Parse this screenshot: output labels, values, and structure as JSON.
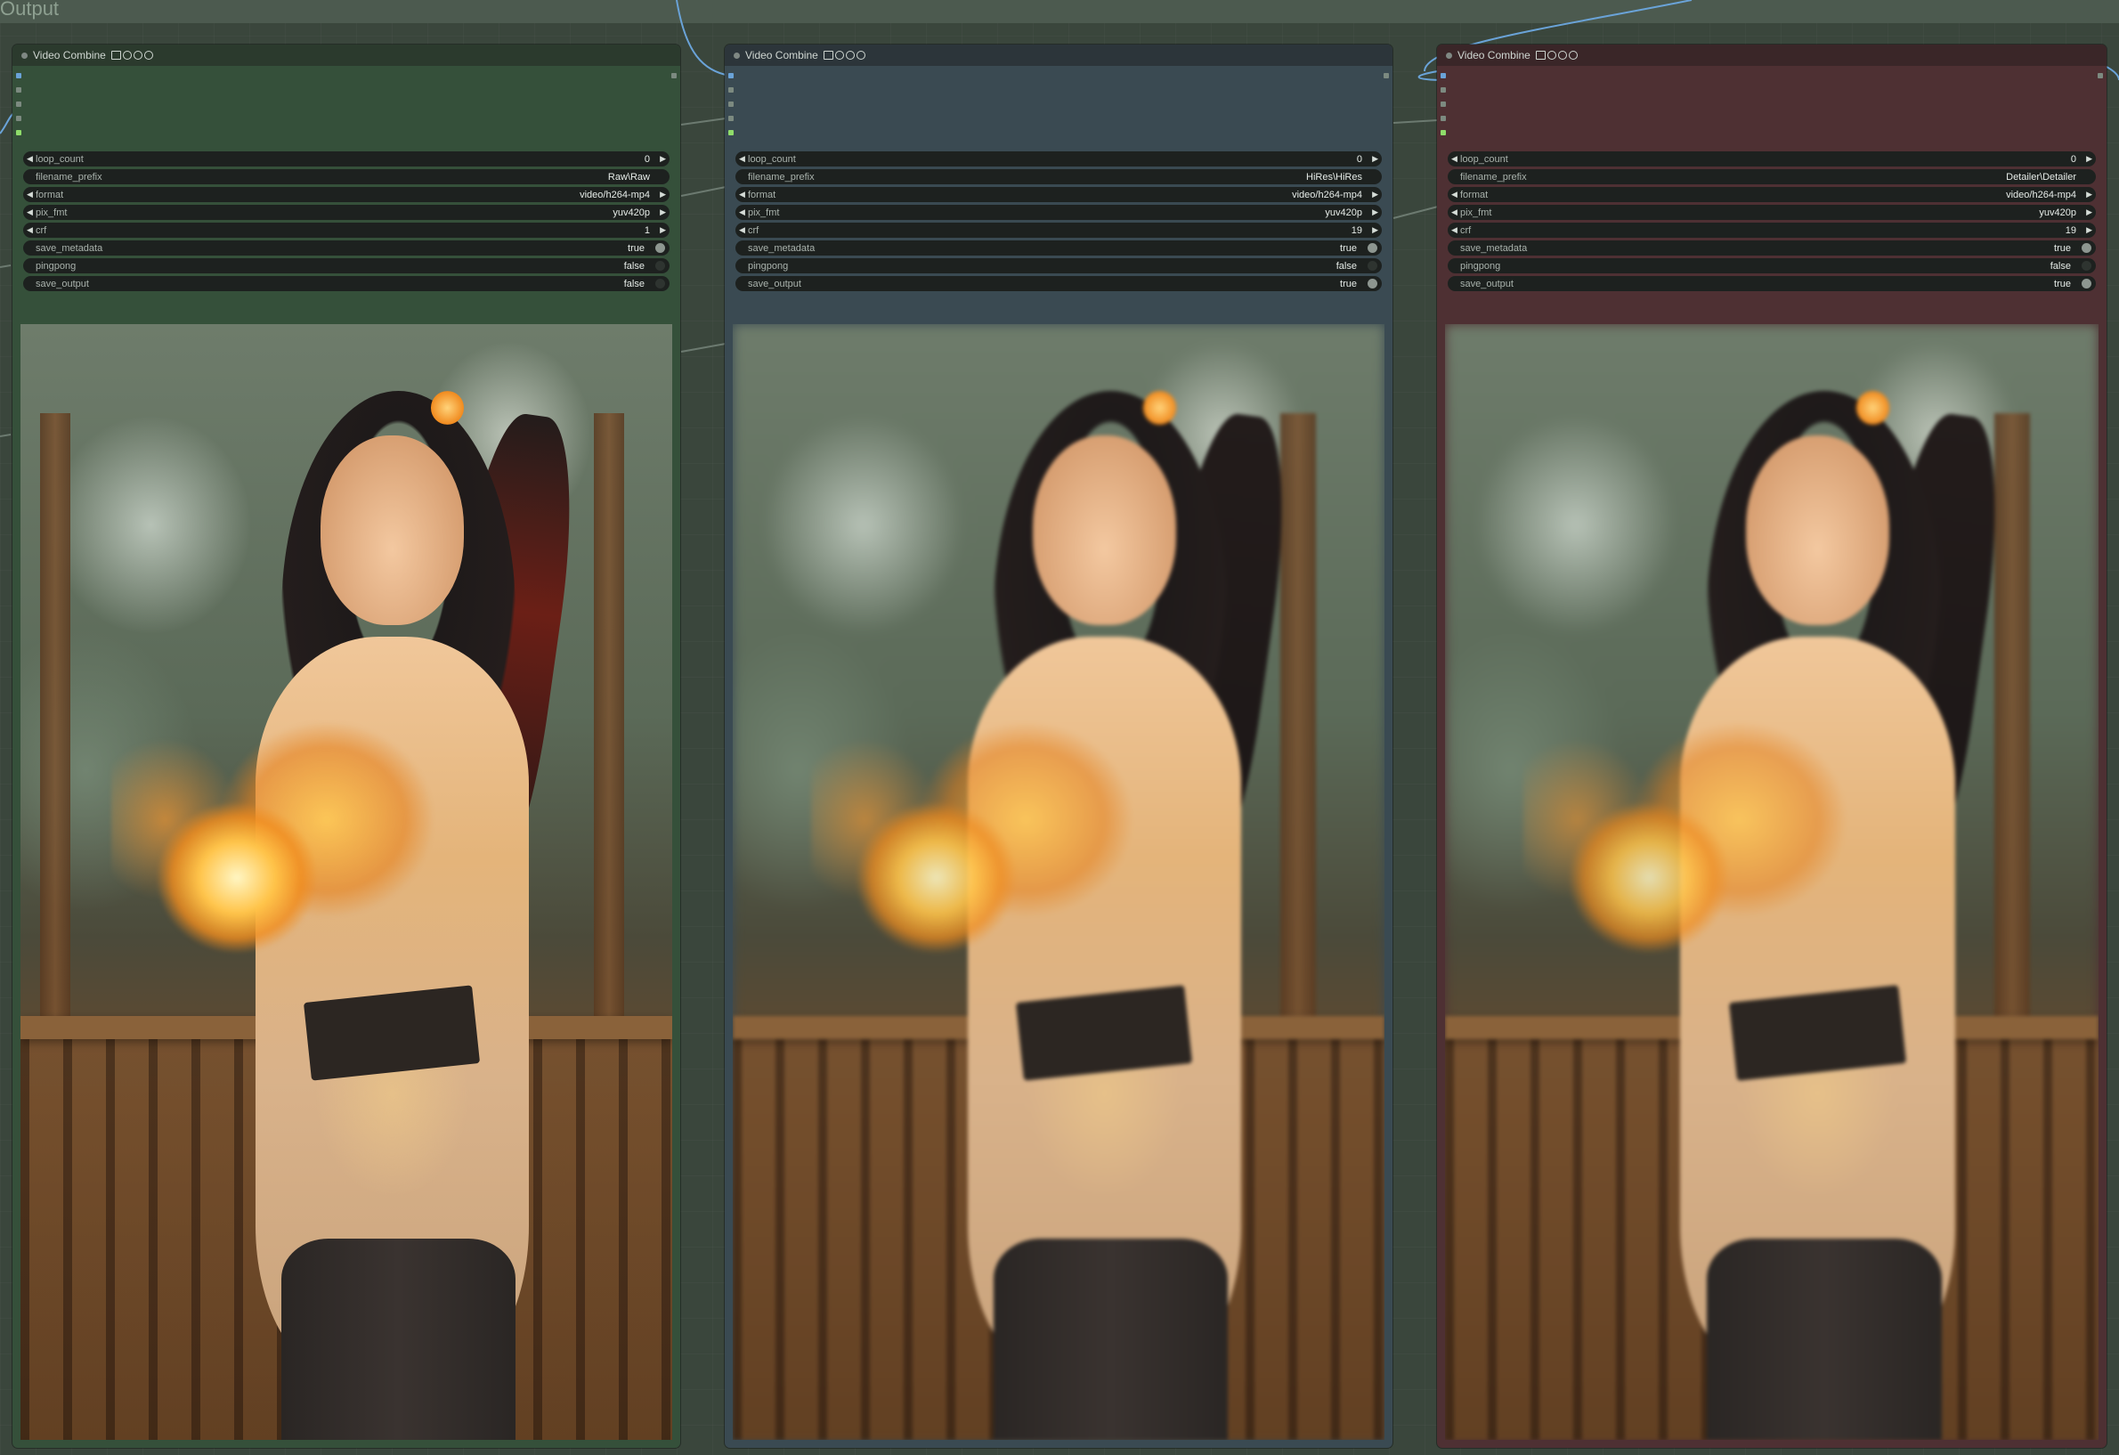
{
  "group": {
    "title": "Output"
  },
  "nodes": [
    {
      "title": "Video Combine",
      "badge_icons": [
        "film-icon",
        "vhs-v-icon",
        "vhs-h-icon",
        "vhs-s-icon"
      ],
      "color": "#35503a",
      "widgets": {
        "loop_count": {
          "name": "loop_count",
          "value": "0"
        },
        "filename_prefix": {
          "name": "filename_prefix",
          "value": "Raw\\Raw"
        },
        "format": {
          "name": "format",
          "value": "video/h264-mp4"
        },
        "pix_fmt": {
          "name": "pix_fmt",
          "value": "yuv420p"
        },
        "crf": {
          "name": "crf",
          "value": "1"
        },
        "save_metadata": {
          "name": "save_metadata",
          "value": "true",
          "on": true
        },
        "pingpong": {
          "name": "pingpong",
          "value": "false",
          "on": false
        },
        "save_output": {
          "name": "save_output",
          "value": "false",
          "on": false
        }
      },
      "preview": {
        "description": "video-preview-raw"
      }
    },
    {
      "title": "Video Combine",
      "badge_icons": [
        "film-icon",
        "vhs-v-icon",
        "vhs-h-icon",
        "vhs-s-icon"
      ],
      "color": "#3a4a52",
      "widgets": {
        "loop_count": {
          "name": "loop_count",
          "value": "0"
        },
        "filename_prefix": {
          "name": "filename_prefix",
          "value": "HiRes\\HiRes"
        },
        "format": {
          "name": "format",
          "value": "video/h264-mp4"
        },
        "pix_fmt": {
          "name": "pix_fmt",
          "value": "yuv420p"
        },
        "crf": {
          "name": "crf",
          "value": "19"
        },
        "save_metadata": {
          "name": "save_metadata",
          "value": "true",
          "on": true
        },
        "pingpong": {
          "name": "pingpong",
          "value": "false",
          "on": false
        },
        "save_output": {
          "name": "save_output",
          "value": "true",
          "on": true
        }
      },
      "preview": {
        "description": "video-preview-hires"
      }
    },
    {
      "title": "Video Combine",
      "badge_icons": [
        "film-icon",
        "vhs-v-icon",
        "vhs-h-icon",
        "vhs-s-icon"
      ],
      "color": "#4e3033",
      "widgets": {
        "loop_count": {
          "name": "loop_count",
          "value": "0"
        },
        "filename_prefix": {
          "name": "filename_prefix",
          "value": "Detailer\\Detailer"
        },
        "format": {
          "name": "format",
          "value": "video/h264-mp4"
        },
        "pix_fmt": {
          "name": "pix_fmt",
          "value": "yuv420p"
        },
        "crf": {
          "name": "crf",
          "value": "19"
        },
        "save_metadata": {
          "name": "save_metadata",
          "value": "true",
          "on": true
        },
        "pingpong": {
          "name": "pingpong",
          "value": "false",
          "on": false
        },
        "save_output": {
          "name": "save_output",
          "value": "true",
          "on": true
        }
      },
      "preview": {
        "description": "video-preview-detailer"
      }
    }
  ]
}
